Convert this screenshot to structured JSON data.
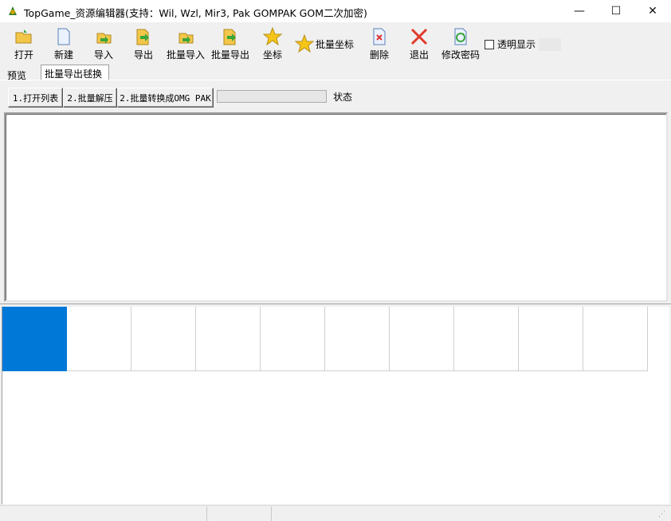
{
  "window": {
    "title": "TopGame_资源编辑器(支持：Wil, Wzl, Mir3, Pak GOMPAK GOM二次加密)",
    "minimize_glyph": "—",
    "maximize_glyph": "☐",
    "close_glyph": "✕"
  },
  "toolbar": {
    "items": [
      {
        "label": "打开",
        "icon": "folder-open-icon"
      },
      {
        "label": "新建",
        "icon": "new-file-icon"
      },
      {
        "label": "导入",
        "icon": "import-icon"
      },
      {
        "label": "导出",
        "icon": "export-icon"
      },
      {
        "label": "批量导入",
        "icon": "batch-import-icon"
      },
      {
        "label": "批量导出",
        "icon": "batch-export-icon"
      },
      {
        "label": "坐标",
        "icon": "star-icon"
      },
      {
        "label": "批量坐标",
        "icon": "star-icon"
      },
      {
        "label": "删除",
        "icon": "delete-file-icon"
      },
      {
        "label": "退出",
        "icon": "exit-x-icon"
      },
      {
        "label": "修改密码",
        "icon": "refresh-password-icon"
      }
    ],
    "transparent_label": "透明显示"
  },
  "tabs": {
    "preview": "预览",
    "batch_export": "批量导出毬换"
  },
  "actions": {
    "open_list": "1.打开列表",
    "batch_extract": "2.批量解压",
    "batch_convert": "2.批量转换成OMG PAK",
    "status_label": "状态"
  },
  "grid": {
    "cell_count": 10,
    "selected_index": 0
  },
  "colors": {
    "selection": "#0078d7",
    "star": "#f5c518",
    "exit_red": "#e03a2a",
    "arrow_green": "#3aa63a"
  }
}
